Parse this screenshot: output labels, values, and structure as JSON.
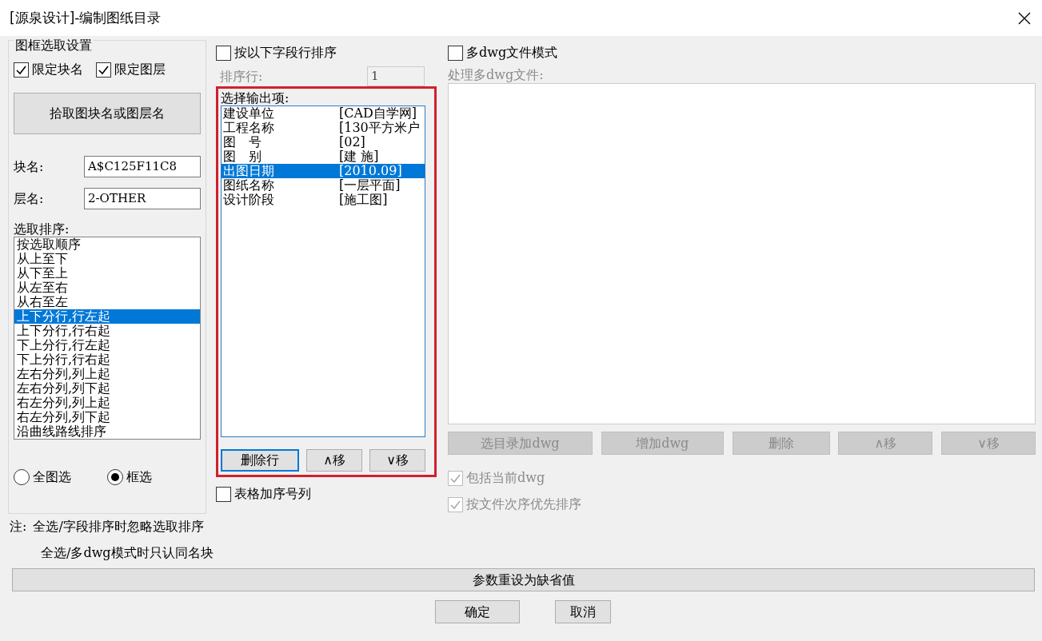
{
  "window": {
    "title": "[源泉设计]-编制图纸目录"
  },
  "frame_group": {
    "title": "图框选取设置",
    "checkboxes": [
      {
        "label": "限定块名",
        "checked": true
      },
      {
        "label": "限定图层",
        "checked": true
      }
    ],
    "pick_button": "拾取图块名或图层名",
    "fields": [
      {
        "label": "块名:",
        "value": "A$C125F11C8"
      },
      {
        "label": "层名:",
        "value": "2-OTHER"
      }
    ],
    "order_label": "选取排序:",
    "order_items": [
      {
        "label": "按选取顺序",
        "selected": false
      },
      {
        "label": "从上至下",
        "selected": false
      },
      {
        "label": "从下至上",
        "selected": false
      },
      {
        "label": "从左至右",
        "selected": false
      },
      {
        "label": "从右至左",
        "selected": false
      },
      {
        "label": "上下分行,行左起",
        "selected": true
      },
      {
        "label": "上下分行,行右起",
        "selected": false
      },
      {
        "label": "下上分行,行左起",
        "selected": false
      },
      {
        "label": "下上分行,行右起",
        "selected": false
      },
      {
        "label": "左右分列,列上起",
        "selected": false
      },
      {
        "label": "左右分列,列下起",
        "selected": false
      },
      {
        "label": "右左分列,列上起",
        "selected": false
      },
      {
        "label": "右左分列,列下起",
        "selected": false
      },
      {
        "label": "沿曲线路线排序",
        "selected": false
      }
    ],
    "radios": [
      {
        "label": "全图选",
        "selected": false
      },
      {
        "label": "框选",
        "selected": true
      }
    ]
  },
  "middle": {
    "sort_checkbox": {
      "label": "按以下字段行排序",
      "checked": false
    },
    "sort_row": {
      "label": "排序行:",
      "value": "1",
      "disabled": true
    },
    "output": {
      "highlighted": true,
      "label": "选择输出项:",
      "items": [
        {
          "name": "建设单位",
          "value": "[CAD自学网]",
          "selected": false
        },
        {
          "name": "工程名称",
          "value": "[130平方米户",
          "selected": false
        },
        {
          "name": "图　号",
          "value": "[02]",
          "selected": false
        },
        {
          "name": "图　别",
          "value": "[建 施]",
          "selected": false
        },
        {
          "name": "出图日期",
          "value": "[2010.09]",
          "selected": true
        },
        {
          "name": "图纸名称",
          "value": "[一层平面]",
          "selected": false
        },
        {
          "name": "设计阶段",
          "value": "[施工图]",
          "selected": false
        }
      ],
      "buttons": [
        {
          "label": "删除行",
          "focused": true
        },
        {
          "label": "∧移",
          "focused": false
        },
        {
          "label": "∨移",
          "focused": false
        }
      ]
    },
    "serial_checkbox": {
      "label": "表格加序号列",
      "checked": false
    }
  },
  "right": {
    "multi_checkbox": {
      "label": "多dwg文件模式",
      "checked": false
    },
    "files_label": "处理多dwg文件:",
    "disabled": true,
    "buttons": [
      "选目录加dwg",
      "增加dwg",
      "删除",
      "∧移",
      "∨移"
    ],
    "checkboxes": [
      {
        "label": "包括当前dwg",
        "checked": true
      },
      {
        "label": "按文件次序优先排序",
        "checked": true
      }
    ]
  },
  "notes": {
    "prefix": "注:",
    "lines": [
      "全选/字段排序时忽略选取排序",
      "全选/多dwg模式时只认同名块"
    ]
  },
  "reset_button": "参数重设为缺省值",
  "footer_buttons": [
    "确定",
    "取消"
  ]
}
